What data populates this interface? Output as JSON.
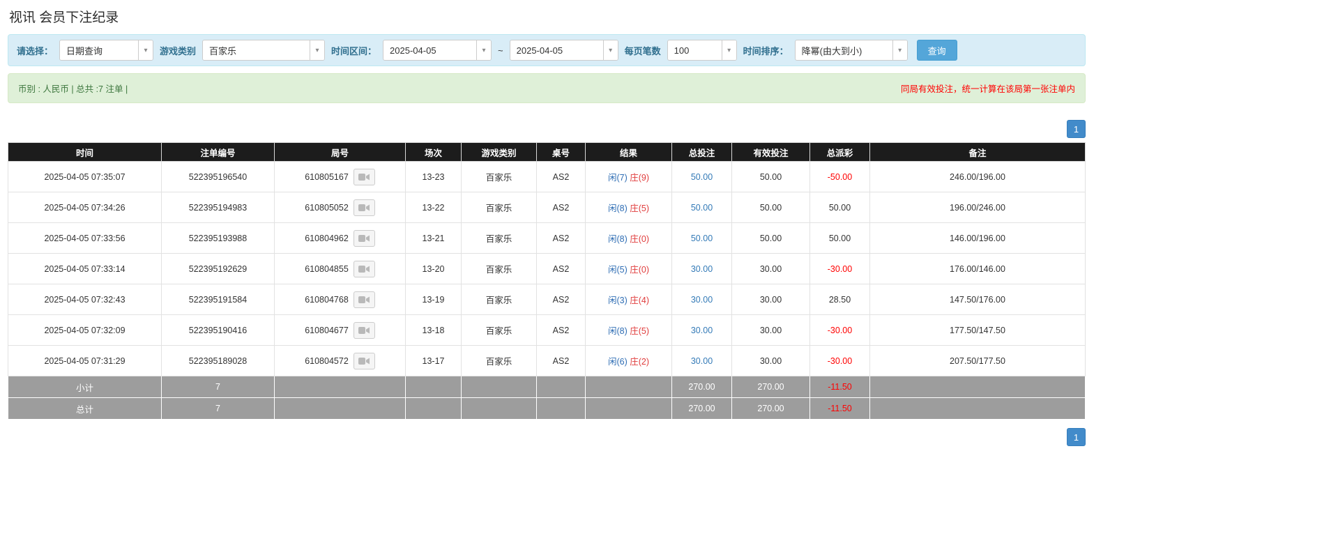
{
  "page": {
    "title": "视讯 会员下注纪录"
  },
  "colors": {
    "filter_bg": "#d9edf7",
    "filter_border": "#bce8f1",
    "filter_label": "#31708f",
    "summary_bg": "#dff0d8",
    "summary_border": "#d6e9c6",
    "summary_text": "#3c763d",
    "note_red": "#ff0000",
    "header_bg": "#1c1c1c",
    "header_text": "#ffffff",
    "row_border": "#e2e2e2",
    "footer_bg": "#9d9d9d",
    "link_blue": "#337ab7",
    "player_blue": "#2e6db4",
    "banker_red": "#e03c3c",
    "neg_red": "#ff0000",
    "btn_blue": "#54a6d9",
    "pager_blue": "#428bca"
  },
  "filters": {
    "select_label": "请选择：",
    "select_value": "日期查询",
    "game_type_label": "游戏类别",
    "game_type_value": "百家乐",
    "time_range_label": "时间区间：",
    "date_from": "2025-04-05",
    "tilde": "~",
    "date_to": "2025-04-05",
    "page_size_label": "每页笔数",
    "page_size_value": "100",
    "sort_label": "时间排序：",
    "sort_value": "降幂(由大到小)",
    "search_button": "查询",
    "caret": "▾"
  },
  "summary": {
    "left": "币别 : 人民币 | 总共 :7 注单 |",
    "right": "同局有效投注，统一计算在该局第一张注单内"
  },
  "pagination": {
    "page": "1"
  },
  "table": {
    "headers": [
      "时间",
      "注单编号",
      "局号",
      "场次",
      "游戏类别",
      "桌号",
      "结果",
      "总投注",
      "有效投注",
      "总派彩",
      "备注"
    ],
    "rows": [
      {
        "time": "2025-04-05 07:35:07",
        "bet_id": "522395196540",
        "round_id": "610805167",
        "session": "13-23",
        "game": "百家乐",
        "table_no": "AS2",
        "result_player": "闲(7)",
        "result_banker": "庄(9)",
        "total_bet": "50.00",
        "valid_bet": "50.00",
        "payout": "-50.00",
        "remark": "246.00/196.00"
      },
      {
        "time": "2025-04-05 07:34:26",
        "bet_id": "522395194983",
        "round_id": "610805052",
        "session": "13-22",
        "game": "百家乐",
        "table_no": "AS2",
        "result_player": "闲(8)",
        "result_banker": "庄(5)",
        "total_bet": "50.00",
        "valid_bet": "50.00",
        "payout": "50.00",
        "remark": "196.00/246.00"
      },
      {
        "time": "2025-04-05 07:33:56",
        "bet_id": "522395193988",
        "round_id": "610804962",
        "session": "13-21",
        "game": "百家乐",
        "table_no": "AS2",
        "result_player": "闲(8)",
        "result_banker": "庄(0)",
        "total_bet": "50.00",
        "valid_bet": "50.00",
        "payout": "50.00",
        "remark": "146.00/196.00"
      },
      {
        "time": "2025-04-05 07:33:14",
        "bet_id": "522395192629",
        "round_id": "610804855",
        "session": "13-20",
        "game": "百家乐",
        "table_no": "AS2",
        "result_player": "闲(5)",
        "result_banker": "庄(0)",
        "total_bet": "30.00",
        "valid_bet": "30.00",
        "payout": "-30.00",
        "remark": "176.00/146.00"
      },
      {
        "time": "2025-04-05 07:32:43",
        "bet_id": "522395191584",
        "round_id": "610804768",
        "session": "13-19",
        "game": "百家乐",
        "table_no": "AS2",
        "result_player": "闲(3)",
        "result_banker": "庄(4)",
        "total_bet": "30.00",
        "valid_bet": "30.00",
        "payout": "28.50",
        "remark": "147.50/176.00"
      },
      {
        "time": "2025-04-05 07:32:09",
        "bet_id": "522395190416",
        "round_id": "610804677",
        "session": "13-18",
        "game": "百家乐",
        "table_no": "AS2",
        "result_player": "闲(8)",
        "result_banker": "庄(5)",
        "total_bet": "30.00",
        "valid_bet": "30.00",
        "payout": "-30.00",
        "remark": "177.50/147.50"
      },
      {
        "time": "2025-04-05 07:31:29",
        "bet_id": "522395189028",
        "round_id": "610804572",
        "session": "13-17",
        "game": "百家乐",
        "table_no": "AS2",
        "result_player": "闲(6)",
        "result_banker": "庄(2)",
        "total_bet": "30.00",
        "valid_bet": "30.00",
        "payout": "-30.00",
        "remark": "207.50/177.50"
      }
    ],
    "subtotal": {
      "label": "小计",
      "count": "7",
      "total_bet": "270.00",
      "valid_bet": "270.00",
      "payout": "-11.50"
    },
    "total": {
      "label": "总计",
      "count": "7",
      "total_bet": "270.00",
      "valid_bet": "270.00",
      "payout": "-11.50"
    }
  }
}
